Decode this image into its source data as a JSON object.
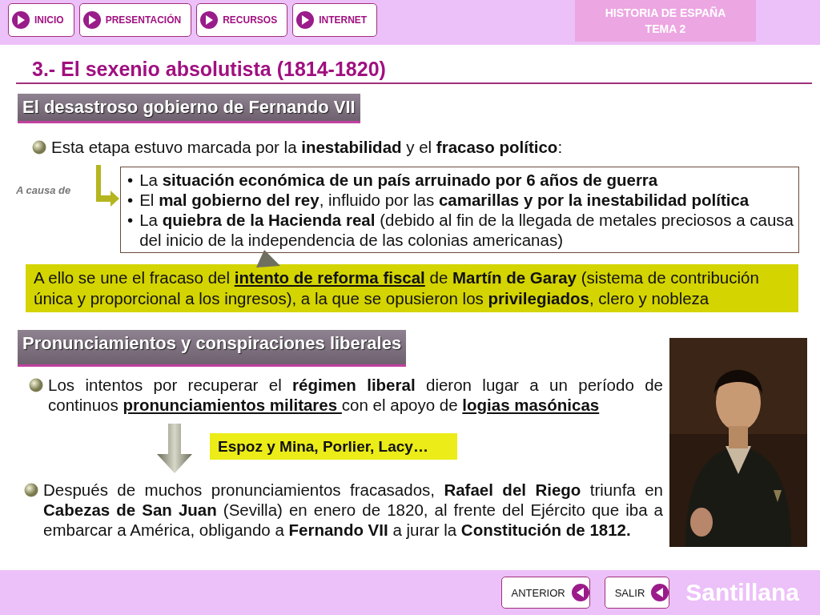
{
  "nav_buttons": [
    {
      "label": "INICIO"
    },
    {
      "label": "PRESENTACIÓN"
    },
    {
      "label": "RECURSOS"
    },
    {
      "label": "INTERNET"
    }
  ],
  "header_badge": {
    "line_1": "HISTORIA DE ESPAÑA",
    "line_2": "TEMA 2"
  },
  "title": "3.- El sexenio absolutista (1814-1820)",
  "section_1": {
    "heading": "El desastroso gobierno de Fernando VII",
    "intro": "Esta etapa estuvo marcada por la **inestabilidad** y el **fracaso político**:",
    "cause_label": "A causa de",
    "causes": [
      {
        "bullet": "•",
        "text": "La **situación económica de un país arruinado por 6 años de guerra**"
      },
      {
        "bullet": "•",
        "text": "El **mal gobierno del rey**, influido por las **camarillas y por la inestabilidad política**"
      },
      {
        "bullet": "•",
        "text": "La **quiebra de la Hacienda real** (debido al fin de la llegada de metales preciosos a causa del inicio de la independencia de las colonias americanas)"
      }
    ],
    "highlight": {
      "before": "A ello se une el fracaso del ",
      "link": "intento de reforma fiscal",
      "after": " de **Martín de Garay** (sistema de contribución única y proporcional a los ingresos), a la que se opusieron los **privilegiados**, clero y nobleza"
    }
  },
  "section_2": {
    "heading": "Pronunciamientos y conspiraciones liberales",
    "paragraph_1": {
      "parts": [
        {
          "text": "Los intentos por recuperar el **régimen liberal** dieron lugar a un período de continuos ",
          "underline": false
        },
        {
          "text": "pronunciamientos militares ",
          "underline": true
        },
        {
          "text": "con el apoyo de ",
          "underline": false
        },
        {
          "text": "logias masónicas",
          "underline": true
        }
      ]
    },
    "note": "Espoz y Mina, Porlier, Lacy…",
    "paragraph_2": "Después de muchos pronunciamientos fracasados, **Rafael del Riego** triunfa en **Cabezas de San Juan** (Sevilla) en enero de 1820, al frente del Ejército que iba a embarcar a América, obligando a **Fernando VII** a jurar la **Constitución de 1812.**"
  },
  "footer_buttons": [
    {
      "label": "ANTERIOR"
    },
    {
      "label": "SALIR"
    }
  ],
  "brand": "Santillana"
}
